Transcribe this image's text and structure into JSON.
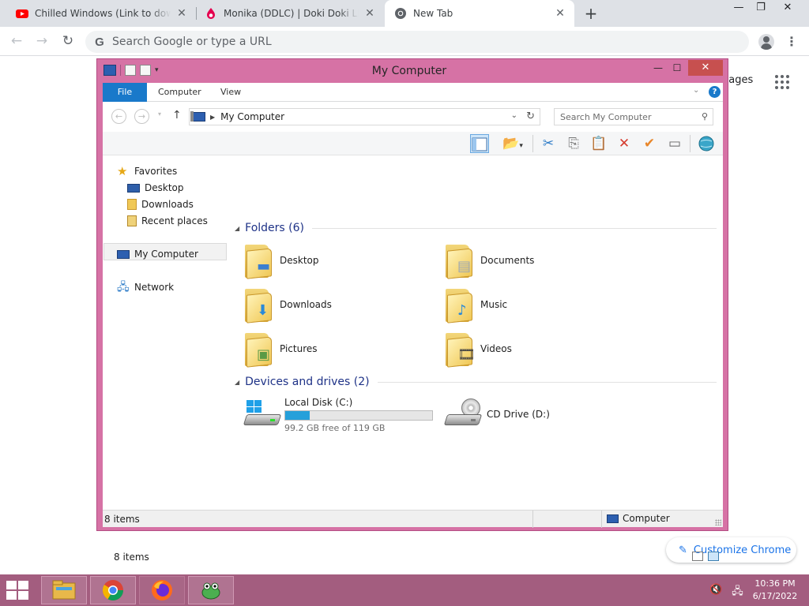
{
  "browser": {
    "tabs": [
      {
        "title": "Chilled Windows (Link to downloa",
        "icon": "youtube-icon"
      },
      {
        "title": "Monika (DDLC) | Doki Doki Litera",
        "icon": "fandom-icon"
      },
      {
        "title": "New Tab",
        "icon": "chrome-icon",
        "active": true
      }
    ],
    "omnibox_placeholder": "Search Google or type a URL",
    "ntp_images_label": "nages",
    "customize_label": "Customize Chrome"
  },
  "explorer": {
    "title": "My Computer",
    "ribbon_tabs": [
      "File",
      "Computer",
      "View"
    ],
    "address": "My Computer",
    "search_placeholder": "Search My Computer",
    "nav": {
      "favorites": "Favorites",
      "desktop": "Desktop",
      "downloads": "Downloads",
      "recent": "Recent places",
      "computer": "My Computer",
      "network": "Network"
    },
    "folders_header": "Folders (6)",
    "folders": [
      "Desktop",
      "Documents",
      "Downloads",
      "Music",
      "Pictures",
      "Videos"
    ],
    "devices_header": "Devices and drives (2)",
    "drives": {
      "c_name": "Local Disk (C:)",
      "c_free": "99.2 GB free of 119 GB",
      "c_used_fraction": 0.166,
      "d_name": "CD Drive (D:)"
    },
    "item_count": "8 items",
    "status_location": "Computer"
  },
  "taskbar": {
    "time": "10:36 PM",
    "date": "6/17/2022"
  },
  "colors": {
    "window_frame": "#d672a5",
    "taskbar": "#a35d7f",
    "ribbon_file": "#1979ca",
    "disk_bar": "#26a0da",
    "section_header": "#1e3287"
  }
}
